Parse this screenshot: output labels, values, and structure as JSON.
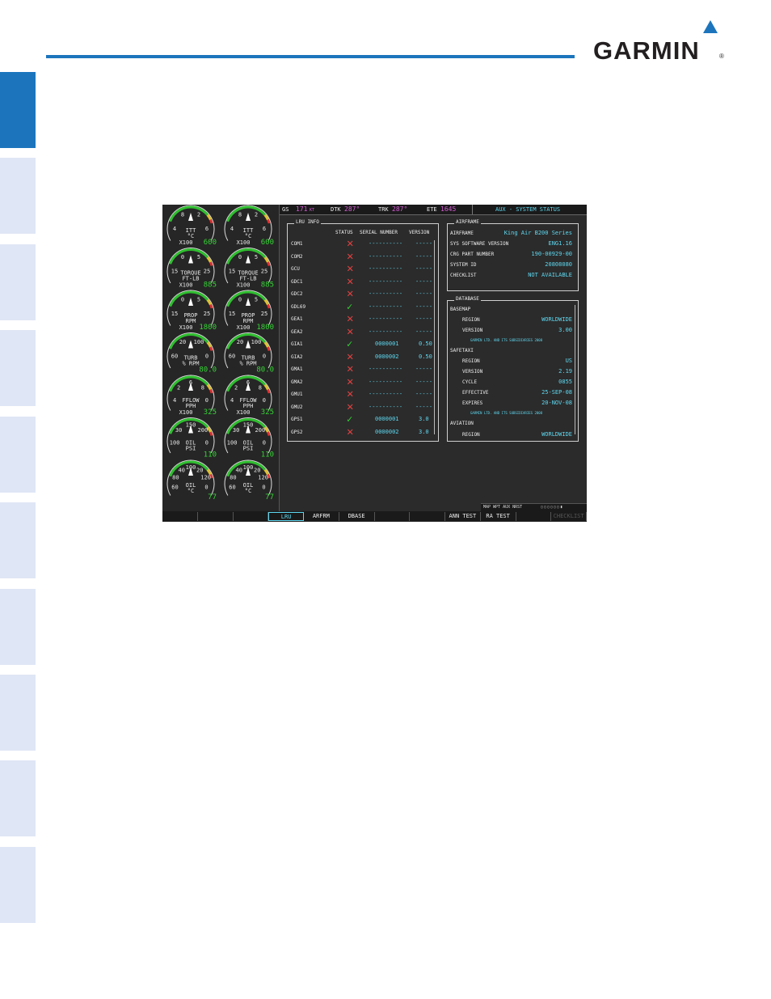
{
  "header": {
    "brand": "GARMIN",
    "registered_mark": "®"
  },
  "display": {
    "topbar": {
      "gs_label": "GS",
      "gs_value": "171",
      "gs_unit": "KT",
      "dtk_label": "DTK",
      "dtk_value": "287°",
      "trk_label": "TRK",
      "trk_value": "287°",
      "ete_label": "ETE",
      "ete_value": "1645",
      "page_title": "AUX - SYSTEM STATUS"
    },
    "eis": {
      "gauges": [
        {
          "name": "ITT",
          "unit": "°C",
          "scale": "X100",
          "value": "600",
          "ticks": [
            "4",
            "8",
            "2",
            "6"
          ]
        },
        {
          "name": "TORQUE",
          "unit": "FT-LB",
          "scale": "X100",
          "value": "885",
          "ticks": [
            "15",
            "0",
            "5",
            "25"
          ]
        },
        {
          "name": "PROP",
          "unit": "RPM",
          "scale": "X100",
          "value": "1800",
          "ticks": [
            "15",
            "0",
            "5",
            "25"
          ]
        },
        {
          "name": "TURB",
          "unit": "% RPM",
          "scale": "",
          "value": "80.0",
          "ticks": [
            "60",
            "20",
            "100",
            "0"
          ]
        },
        {
          "name": "FFLOW",
          "unit": "PPH",
          "scale": "X100",
          "value": "325",
          "ticks": [
            "4",
            "2",
            "6",
            "8",
            "0"
          ]
        },
        {
          "name": "OIL",
          "unit": "PSI",
          "scale": "",
          "value": "110",
          "ticks": [
            "100",
            "30",
            "150",
            "200",
            "0"
          ]
        },
        {
          "name": "OIL",
          "unit": "°C",
          "scale": "",
          "value": "77",
          "ticks": [
            "60",
            "80",
            "40",
            "100",
            "20",
            "120",
            "0"
          ]
        }
      ]
    },
    "lru_info": {
      "title": "LRU INFO",
      "columns": [
        "STATUS",
        "SERIAL NUMBER",
        "VERSION"
      ],
      "rows": [
        {
          "lru": "COM1",
          "status": "fail",
          "serial": "----------",
          "version": "-----"
        },
        {
          "lru": "COM2",
          "status": "fail",
          "serial": "----------",
          "version": "-----"
        },
        {
          "lru": "GCU",
          "status": "fail",
          "serial": "----------",
          "version": "-----"
        },
        {
          "lru": "GDC1",
          "status": "fail",
          "serial": "----------",
          "version": "-----"
        },
        {
          "lru": "GDC2",
          "status": "fail",
          "serial": "----------",
          "version": "-----"
        },
        {
          "lru": "GDL69",
          "status": "ok",
          "serial": "----------",
          "version": "-----"
        },
        {
          "lru": "GEA1",
          "status": "fail",
          "serial": "----------",
          "version": "-----"
        },
        {
          "lru": "GEA2",
          "status": "fail",
          "serial": "----------",
          "version": "-----"
        },
        {
          "lru": "GIA1",
          "status": "ok",
          "serial": "0000001",
          "version": "0.50"
        },
        {
          "lru": "GIA2",
          "status": "fail",
          "serial": "0000002",
          "version": "0.50"
        },
        {
          "lru": "GMA1",
          "status": "fail",
          "serial": "----------",
          "version": "-----"
        },
        {
          "lru": "GMA2",
          "status": "fail",
          "serial": "----------",
          "version": "-----"
        },
        {
          "lru": "GMU1",
          "status": "fail",
          "serial": "----------",
          "version": "-----"
        },
        {
          "lru": "GMU2",
          "status": "fail",
          "serial": "----------",
          "version": "-----"
        },
        {
          "lru": "GPS1",
          "status": "ok",
          "serial": "0000001",
          "version": "3.0"
        },
        {
          "lru": "GPS2",
          "status": "fail",
          "serial": "0000002",
          "version": "3.0"
        }
      ]
    },
    "airframe": {
      "title": "AIRFRAME",
      "rows": [
        {
          "label": "AIRFRAME",
          "value": "King Air B200 Series"
        },
        {
          "label": "SYS SOFTWARE VERSION",
          "value": "ENG1.16"
        },
        {
          "label": "CRG PART NUMBER",
          "value": "190-00929-00"
        },
        {
          "label": "SYSTEM ID",
          "value": "20808080"
        },
        {
          "label": "CHECKLIST",
          "value": "NOT AVAILABLE"
        }
      ]
    },
    "database": {
      "title": "DATABASE",
      "basemap_label": "BASEMAP",
      "basemap_region_label": "REGION",
      "basemap_region": "WORLDWIDE",
      "basemap_version_label": "VERSION",
      "basemap_version": "3.00",
      "basemap_copyright": "GARMIN LTD. AND ITS SUBSIDIARIES 2008",
      "safetaxi_label": "SAFETAXI",
      "safetaxi_region_label": "REGION",
      "safetaxi_region": "US",
      "safetaxi_version_label": "VERSION",
      "safetaxi_version": "2.19",
      "safetaxi_cycle_label": "CYCLE",
      "safetaxi_cycle": "0855",
      "safetaxi_effective_label": "EFFECTIVE",
      "safetaxi_effective": "25-SEP-08",
      "safetaxi_expires_label": "EXPIRES",
      "safetaxi_expires": "20-NOV-08",
      "safetaxi_copyright": "GARMIN LTD. AND ITS SUBSIDIARIES 2008",
      "aviation_label": "AVIATION",
      "aviation_region_label": "REGION",
      "aviation_region": "WORLDWIDE"
    },
    "page_group": "MAP WPT AUX NRST",
    "softkeys": [
      "",
      "",
      "",
      "LRU",
      "ARFRM",
      "DBASE",
      "",
      "",
      "ANN TEST",
      "RA TEST",
      "",
      "CHECKLIST"
    ],
    "active_softkey": "LRU"
  }
}
